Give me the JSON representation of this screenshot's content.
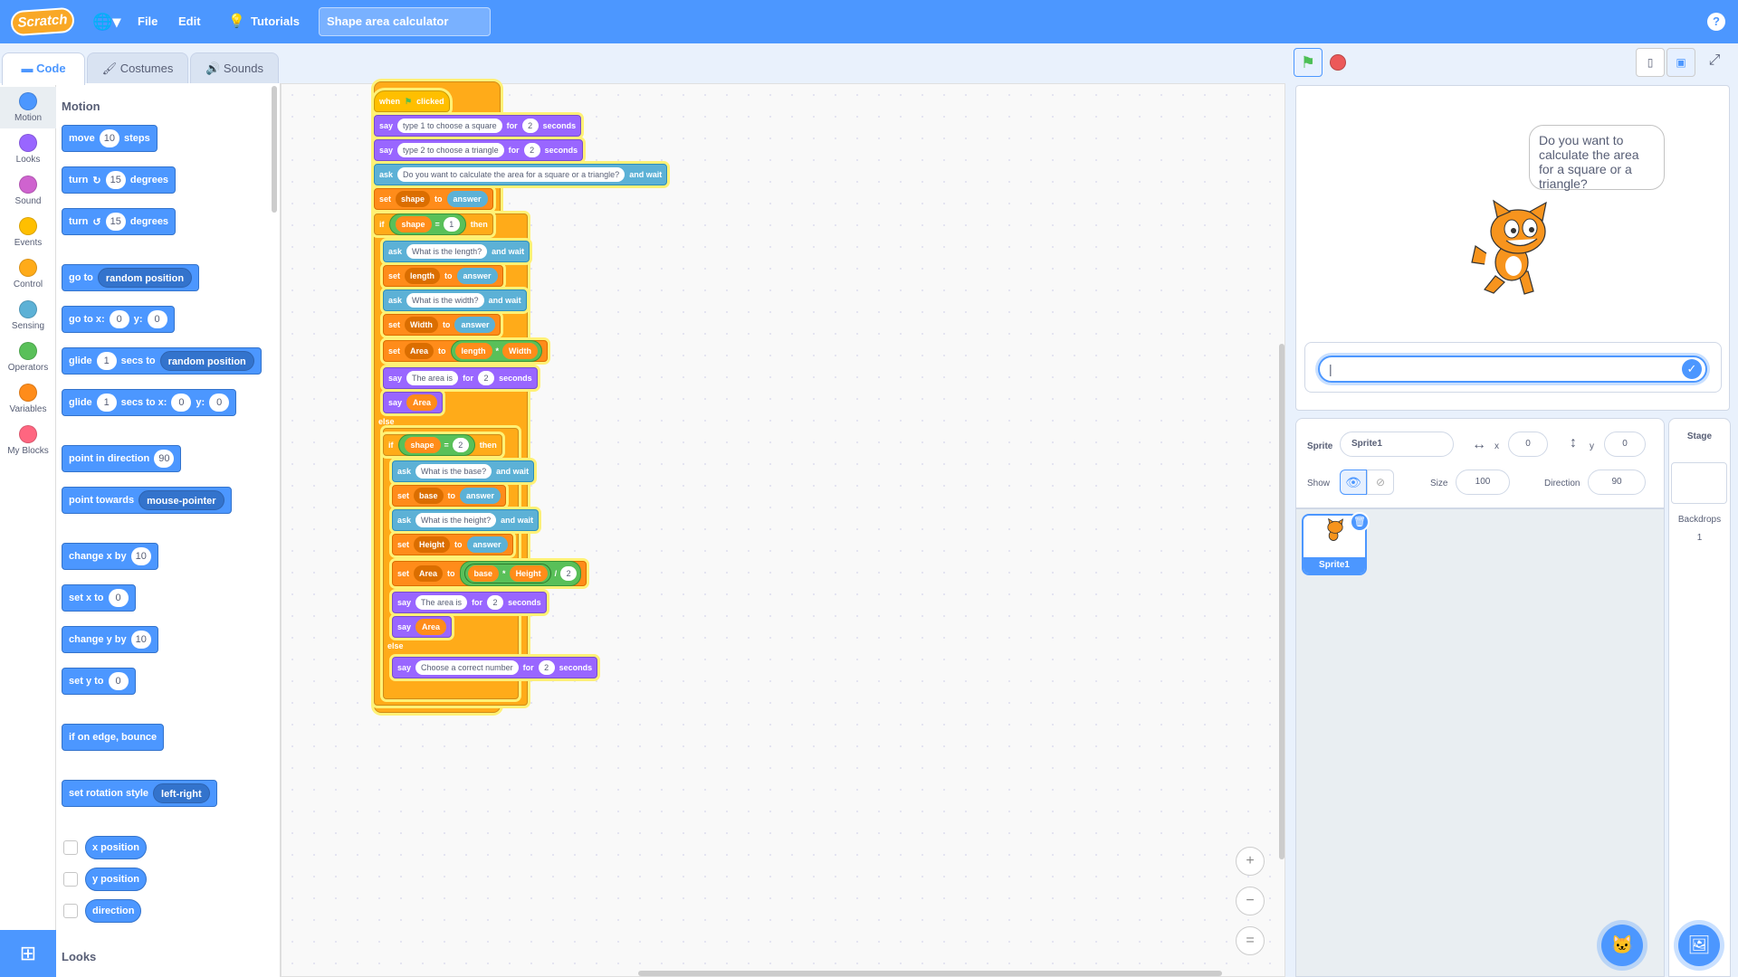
{
  "menubar": {
    "logo": "Scratch",
    "file": "File",
    "edit": "Edit",
    "tutorials": "Tutorials",
    "project_title": "Shape area calculator",
    "help": "?"
  },
  "tabs": [
    "Code",
    "Costumes",
    "Sounds"
  ],
  "categories": [
    {
      "label": "Motion",
      "color": "#4c97ff"
    },
    {
      "label": "Looks",
      "color": "#9966ff"
    },
    {
      "label": "Sound",
      "color": "#cf63cf"
    },
    {
      "label": "Events",
      "color": "#ffbf00"
    },
    {
      "label": "Control",
      "color": "#ffab19"
    },
    {
      "label": "Sensing",
      "color": "#5cb1d6"
    },
    {
      "label": "Operators",
      "color": "#59c059"
    },
    {
      "label": "Variables",
      "color": "#ff8c1a"
    },
    {
      "label": "My Blocks",
      "color": "#ff6680"
    }
  ],
  "palette": {
    "motion_heading": "Motion",
    "looks_heading": "Looks",
    "move": {
      "a": "move",
      "v": "10",
      "b": "steps"
    },
    "turn_cw": {
      "a": "turn",
      "v": "15",
      "b": "degrees"
    },
    "turn_ccw": {
      "a": "turn",
      "v": "15",
      "b": "degrees"
    },
    "goto": {
      "a": "go to",
      "dd": "random position"
    },
    "gotoxy": {
      "a": "go to x:",
      "x": "0",
      "b": "y:",
      "y": "0"
    },
    "glide1": {
      "a": "glide",
      "v": "1",
      "b": "secs to",
      "dd": "random position"
    },
    "glide2": {
      "a": "glide",
      "v": "1",
      "b": "secs to x:",
      "x": "0",
      "c": "y:",
      "y": "0"
    },
    "point_dir": {
      "a": "point in direction",
      "v": "90"
    },
    "point_towards": {
      "a": "point towards",
      "dd": "mouse-pointer"
    },
    "change_x": {
      "a": "change x by",
      "v": "10"
    },
    "set_x": {
      "a": "set x to",
      "v": "0"
    },
    "change_y": {
      "a": "change y by",
      "v": "10"
    },
    "set_y": {
      "a": "set y to",
      "v": "0"
    },
    "bounce": "if on edge, bounce",
    "rot_style": {
      "a": "set rotation style",
      "dd": "left-right"
    },
    "x_position": "x position",
    "y_position": "y position",
    "direction": "direction"
  },
  "script": {
    "hat": {
      "a": "when",
      "b": "clicked"
    },
    "say1": {
      "a": "say",
      "t": "type 1 to choose a square",
      "b": "for",
      "n": "2",
      "c": "seconds"
    },
    "say2": {
      "a": "say",
      "t": "type 2 to choose a triangle",
      "b": "for",
      "n": "2",
      "c": "seconds"
    },
    "ask1": {
      "a": "ask",
      "t": "Do you want to calculate the area for a square or a triangle?",
      "b": "and wait"
    },
    "set_shape": {
      "a": "set",
      "var": "shape",
      "b": "to",
      "val": "answer"
    },
    "if1": {
      "a": "if",
      "var": "shape",
      "op": "=",
      "n": "1",
      "b": "then"
    },
    "ask_len": {
      "a": "ask",
      "t": "What is the length?",
      "b": "and wait"
    },
    "set_len": {
      "a": "set",
      "var": "length",
      "b": "to",
      "val": "answer"
    },
    "ask_wid": {
      "a": "ask",
      "t": "What is the width?",
      "b": "and wait"
    },
    "set_wid": {
      "a": "set",
      "var": "Width",
      "b": "to",
      "val": "answer"
    },
    "set_area1": {
      "a": "set",
      "var": "Area",
      "b": "to",
      "l": "length",
      "op": "*",
      "r": "Width"
    },
    "say_area1": {
      "a": "say",
      "t": "The area is",
      "b": "for",
      "n": "2",
      "c": "seconds"
    },
    "say_area1b": {
      "a": "say",
      "v": "Area"
    },
    "else1": "else",
    "if2": {
      "a": "if",
      "var": "shape",
      "op": "=",
      "n": "2",
      "b": "then"
    },
    "ask_base": {
      "a": "ask",
      "t": "What is the base?",
      "b": "and wait"
    },
    "set_base": {
      "a": "set",
      "var": "base",
      "b": "to",
      "val": "answer"
    },
    "ask_hgt": {
      "a": "ask",
      "t": "What is the height?",
      "b": "and wait"
    },
    "set_hgt": {
      "a": "set",
      "var": "Height",
      "b": "to",
      "val": "answer"
    },
    "set_area2": {
      "a": "set",
      "var": "Area",
      "b": "to",
      "l": "base",
      "op": "*",
      "r": "Height",
      "op2": "/",
      "n": "2"
    },
    "say_area2": {
      "a": "say",
      "t": "The area is",
      "b": "for",
      "n": "2",
      "c": "seconds"
    },
    "say_area2b": {
      "a": "say",
      "v": "Area"
    },
    "else2": "else",
    "say_err": {
      "a": "say",
      "t": "Choose a correct number",
      "b": "for",
      "n": "2",
      "c": "seconds"
    }
  },
  "zoom": {
    "in": "+",
    "out": "−",
    "reset": "="
  },
  "stage": {
    "bubble": "Do you want to calculate the area for a square or a triangle?",
    "ask_value": "|",
    "ask_ok": "✓"
  },
  "sprite_info": {
    "sprite_label": "Sprite",
    "sprite_name": "Sprite1",
    "x_label": "x",
    "x": "0",
    "y_label": "y",
    "y": "0",
    "show_label": "Show",
    "size_label": "Size",
    "size": "100",
    "direction_label": "Direction",
    "direction": "90"
  },
  "sprites": [
    {
      "name": "Sprite1"
    }
  ],
  "stage_panel": {
    "title": "Stage",
    "backdrops_label": "Backdrops",
    "backdrops_count": "1"
  }
}
